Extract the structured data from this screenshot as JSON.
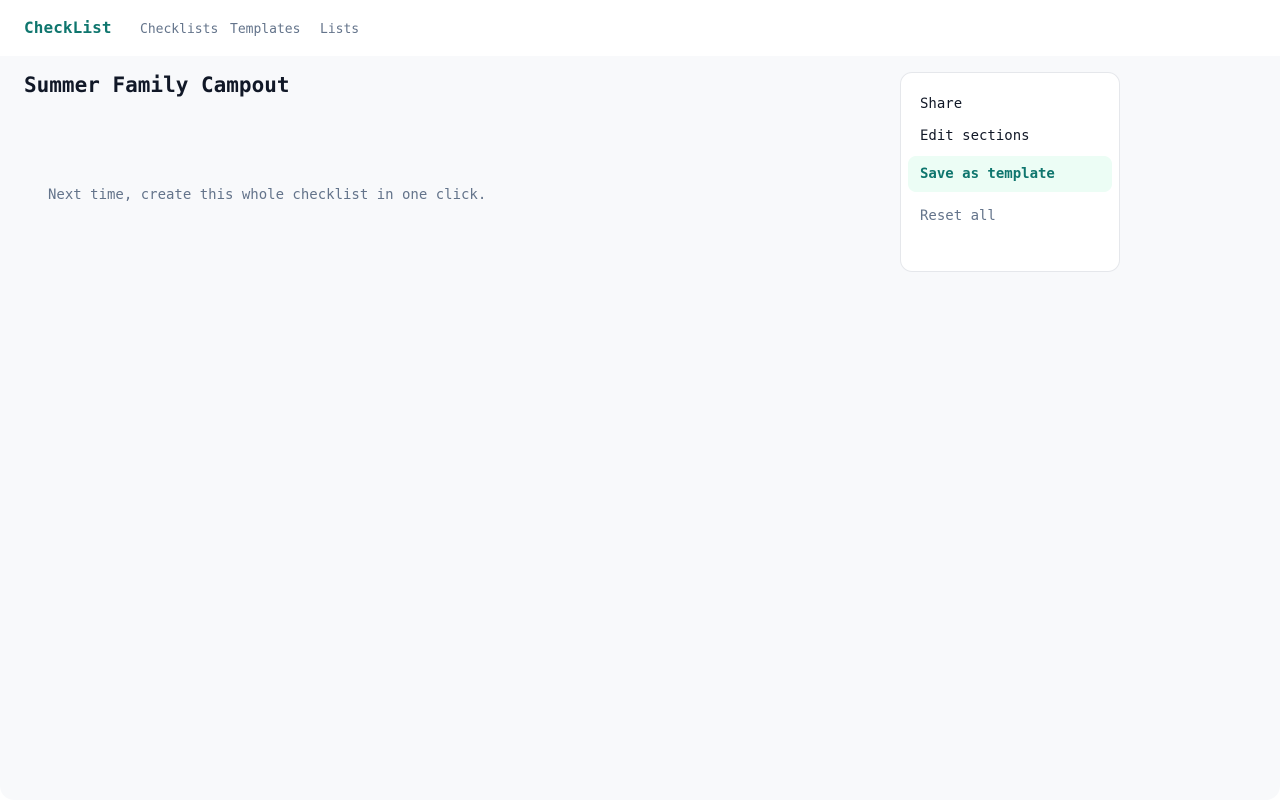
{
  "header": {
    "brand": "CheckList",
    "nav": [
      {
        "label": "Checklists"
      },
      {
        "label": "Templates"
      },
      {
        "label": "Lists"
      }
    ]
  },
  "main": {
    "title": "Summer Family Campout",
    "hint": "Next time, create this whole checklist in one click."
  },
  "menu": {
    "items": [
      {
        "label": "Share"
      },
      {
        "label": "Edit sections"
      },
      {
        "label": "Save as template",
        "highlighted": true
      },
      {
        "label": "Reset all",
        "muted": true
      }
    ]
  },
  "colors": {
    "brand": "#0f766e",
    "highlight_bg": "#ecfdf5",
    "muted_text": "#64748b",
    "page_bg": "#f8f9fb"
  }
}
